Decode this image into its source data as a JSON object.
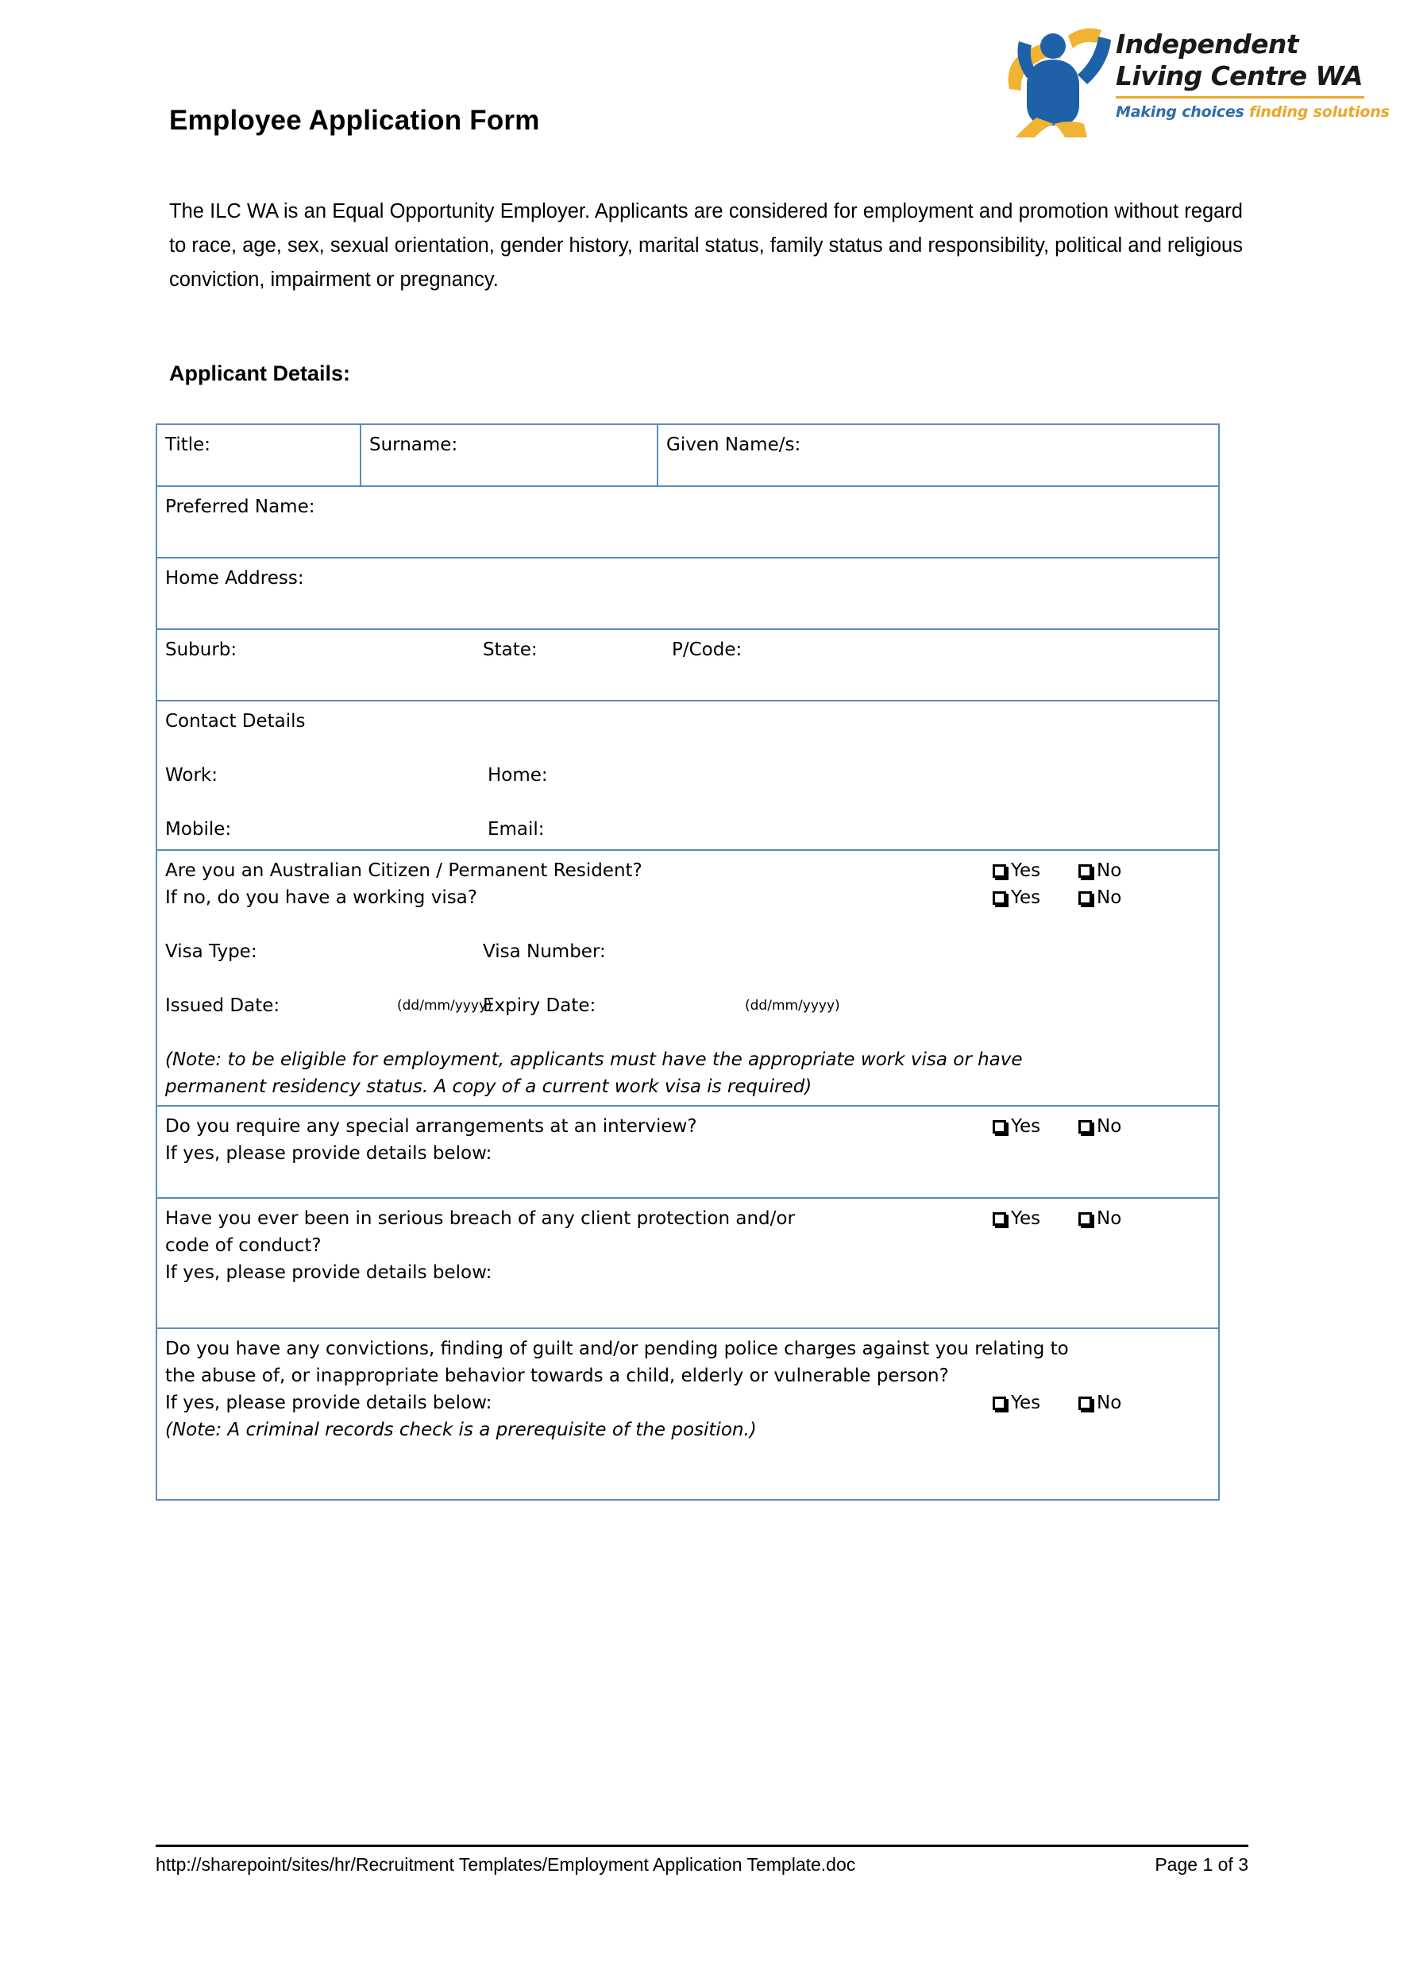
{
  "document": {
    "title": "Employee Application Form",
    "intro_paragraph": "The ILC WA is an Equal Opportunity Employer.  Applicants are considered for employment and promotion without regard to race, age, sex, sexual orientation, gender history, marital status, family status and responsibility, political and religious conviction, impairment or pregnancy.",
    "section_heading": "Applicant Details:"
  },
  "logo": {
    "line1": "Independent",
    "line2": "Living Centre WA",
    "tagline_part1": "Making choices ",
    "tagline_part2": "finding solutions",
    "brand_blue": "#1F61A8",
    "brand_gold": "#F2B233",
    "rule_color": "#E9A72C"
  },
  "theme": {
    "table_border": "#5B8CBE"
  },
  "form": {
    "name_row": {
      "title_label": "Title:",
      "surname_label": "Surname:",
      "given_names_label": "Given Name/s:"
    },
    "preferred_name_label": "Preferred Name:",
    "home_address_label": "Home Address:",
    "suburb_row": {
      "suburb_label": "Suburb:",
      "state_label": "State:",
      "pcode_label": "P/Code:"
    },
    "contact": {
      "heading": "Contact Details",
      "work_label": "Work:",
      "home_label": "Home:",
      "mobile_label": "Mobile:",
      "email_label": "Email:"
    },
    "citizenship": {
      "question1": "Are you an Australian Citizen / Permanent Resident?",
      "question2": "If no, do you have a working visa?",
      "visa_type_label": "Visa Type:",
      "visa_number_label": "Visa Number:",
      "issued_date_label": "Issued Date:",
      "issued_date_format": "(dd/mm/yyyy)",
      "expiry_date_label": "Expiry Date:",
      "expiry_date_format": "(dd/mm/yyyy)",
      "note_line1": "(Note: to be eligible for employment, applicants must have the appropriate work visa or have",
      "note_line2": "permanent residency status. A copy of a current work visa is required)"
    },
    "special_arrangements": {
      "question": "Do you require any special arrangements at an interview?",
      "followup": "If yes, please provide details below:"
    },
    "breach": {
      "question_line1": "Have you ever been in serious breach of any client protection and/or",
      "question_line2": "code of conduct?",
      "followup": "If yes, please provide details below:"
    },
    "convictions": {
      "question_line1": "Do you have any convictions, finding of guilt and/or pending police charges against you relating to",
      "question_line2": "the abuse of, or inappropriate behavior towards a child, elderly or vulnerable person?",
      "followup": "If yes, please provide details below:",
      "note": "(Note: A criminal records check is a prerequisite of the position.)"
    },
    "yes_label": "Yes",
    "no_label": "No"
  },
  "footer": {
    "path": "http://sharepoint/sites/hr/Recruitment Templates/Employment Application Template.doc",
    "page": "Page 1 of 3"
  }
}
